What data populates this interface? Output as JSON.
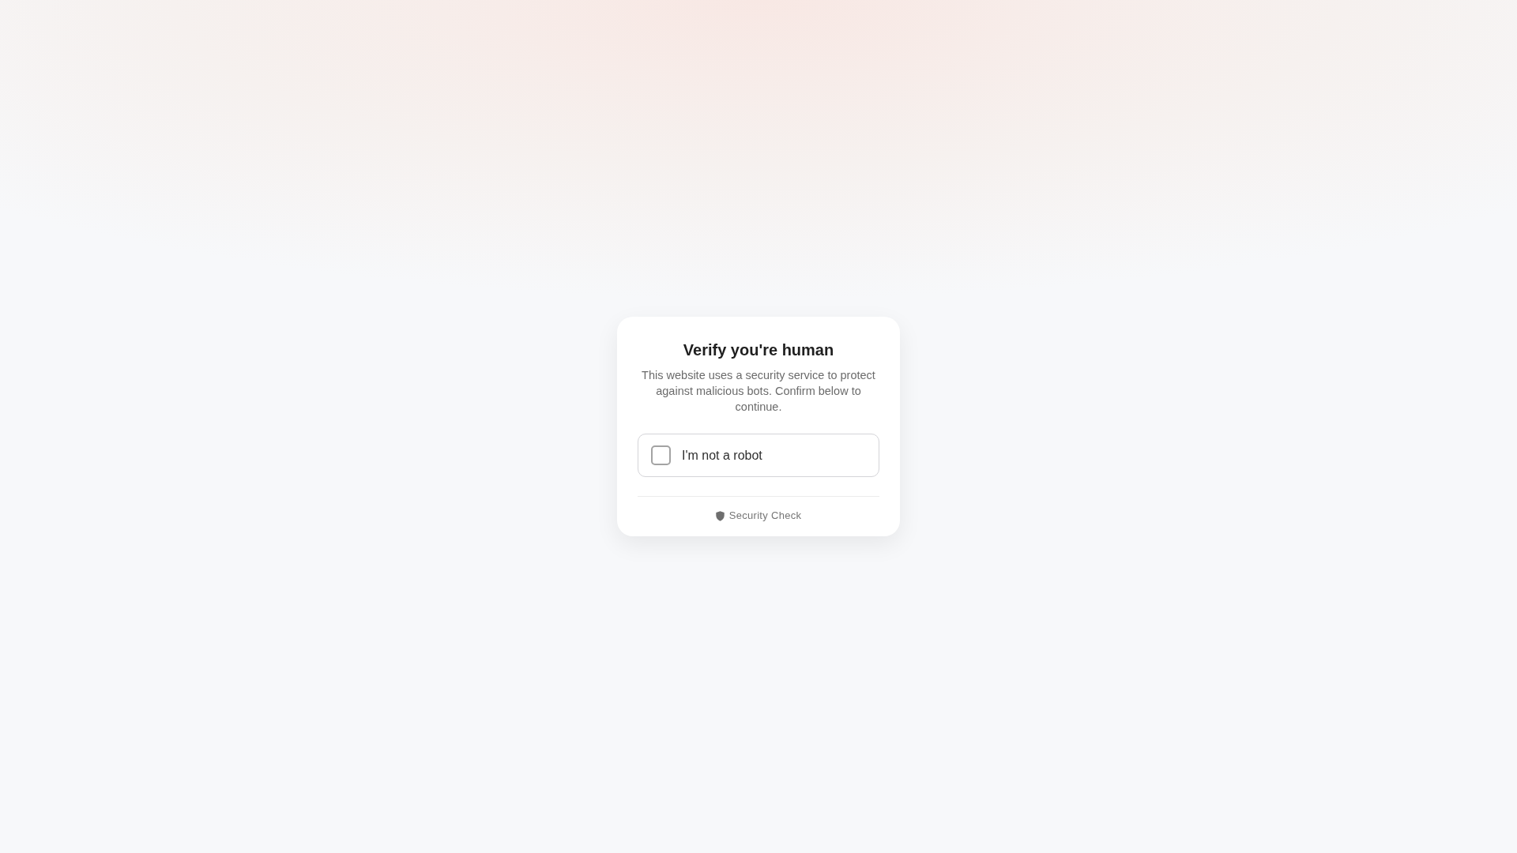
{
  "card": {
    "title": "Verify you're human",
    "description": "This website uses a security service to protect against malicious bots. Confirm below to continue.",
    "checkbox": {
      "label": "I'm not a robot",
      "checked": false
    },
    "footer": {
      "label": "Security Check"
    }
  }
}
